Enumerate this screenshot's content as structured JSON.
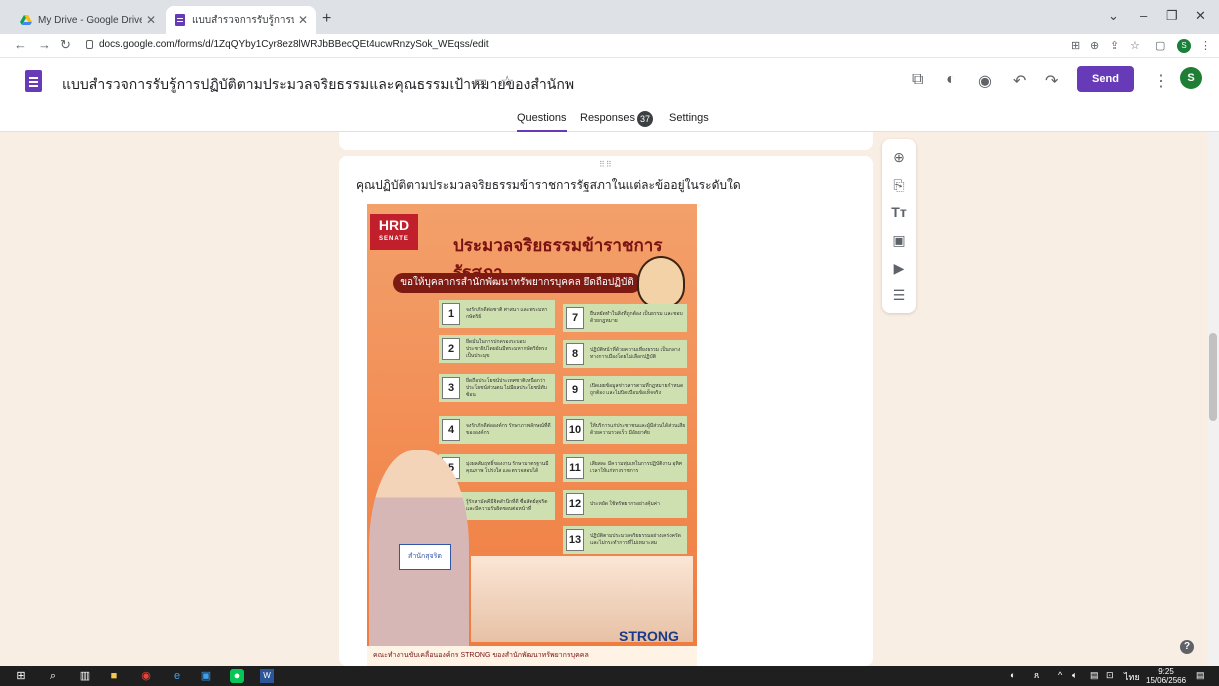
{
  "browser": {
    "tabs": [
      {
        "title": "My Drive - Google Drive",
        "active": false
      },
      {
        "title": "แบบสำรวจการรับรู้การปฏิบัติตามประ",
        "active": true
      }
    ],
    "url": "docs.google.com/forms/d/1ZqQYby1Cyr8ez8lWRJbBBecQEt4ucwRnzySok_WEqss/edit",
    "profile_initial": "S"
  },
  "header": {
    "form_title": "แบบสำรวจการรับรู้การปฏิบัติตามประมวลจริยธรรมและคุณธรรมเป้าหมายของสำนักพ",
    "send_label": "Send",
    "avatar_initial": "S",
    "tabs": {
      "questions": "Questions",
      "responses": "Responses",
      "settings": "Settings"
    },
    "responses_count": "37"
  },
  "question": {
    "text": "คุณปฏิบัติตามประมวลจริยธรรมข้าราชการรัฐสภาในแต่ละข้ออยู่ในระดับใด"
  },
  "poster": {
    "logo_text": "HRD",
    "logo_subtext": "SENATE",
    "title": "ประมวลจริยธรรมข้าราชการรัฐสภา",
    "slogan": "ขอให้บุคลากรสำนักพัฒนาทรัพยากรบุคคล ยึดถือปฏิบัติ",
    "items": [
      {
        "n": "1",
        "text": "จงรักภักดีต่อชาติ ศาสนา และพระมหากษัตริย์"
      },
      {
        "n": "2",
        "text": "ยึดมั่นในการปกครองระบอบประชาธิปไตยอันมีพระมหากษัตริย์ทรงเป็นประมุข"
      },
      {
        "n": "3",
        "text": "ยึดถือประโยชน์ประเทศชาติเหนือกว่าประโยชน์ส่วนตน ไม่มีผลประโยชน์ทับซ้อน"
      },
      {
        "n": "4",
        "text": "จงรักภักดีต่อองค์กร รักษาภาพลักษณ์ที่ดีขององค์กร"
      },
      {
        "n": "5",
        "text": "มุ่งผลสัมฤทธิ์ของงาน รักษามาตรฐานมีคุณภาพ โปร่งใส และตรวจสอบได้"
      },
      {
        "n": "6",
        "text": "รู้รักสามัคคีมีจิตสำนึกที่ดี ซื่อสัตย์สุจริต และมีความรับผิดชอบต่อหน้าที่"
      },
      {
        "n": "7",
        "text": "ยืนหยัดทำในสิ่งที่ถูกต้อง เป็นธรรม และชอบด้วยกฎหมาย"
      },
      {
        "n": "8",
        "text": "ปฏิบัติหน้าที่ด้วยความเที่ยงธรรม เป็นกลางทางการเมืองโดยไม่เลือกปฏิบัติ"
      },
      {
        "n": "9",
        "text": "เปิดเผยข้อมูลข่าวสารตามที่กฎหมายกำหนด ถูกต้อง และไม่บิดเบือนข้อเท็จจริง"
      },
      {
        "n": "10",
        "text": "ให้บริการแก่ประชาชนและผู้มีส่วนได้ส่วนเสียด้วยความรวดเร็ว มีอัธยาศัย"
      },
      {
        "n": "11",
        "text": "เสียสละ มีความทุ่มเทในการปฏิบัติงาน อุทิศเวลาให้แก่ทางราชการ"
      },
      {
        "n": "12",
        "text": "ประหยัด ใช้ทรัพยากรอย่างคุ้มค่า"
      },
      {
        "n": "13",
        "text": "ปฏิบัติตามประมวลจริยธรรมอย่างเคร่งครัด และไม่กระทำการที่ไม่เหมาะสม"
      }
    ],
    "sign_text": "สำนักสุจริต",
    "strong_text": "STRONG",
    "footer_text": "คณะทำงานขับเคลื่อนองค์กร STRONG ของสำนักพัฒนาทรัพยากรบุคคล"
  },
  "taskbar": {
    "time": "9:25",
    "date": "15/06/2566",
    "lang": "ไทย"
  }
}
